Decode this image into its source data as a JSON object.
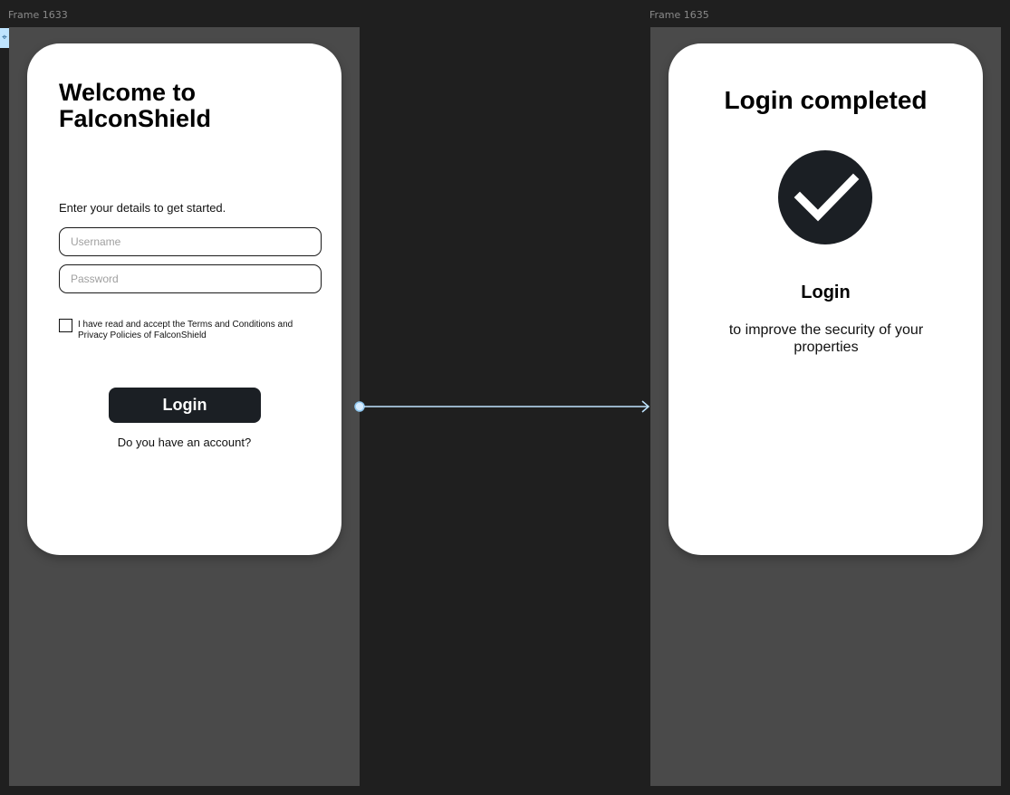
{
  "frames": [
    {
      "label": "Frame 1633"
    },
    {
      "label": "Frame 1635"
    }
  ],
  "login_screen": {
    "title": "Welcome to FalconShield",
    "intro": "Enter your details to get started.",
    "username_placeholder": "Username",
    "password_placeholder": "Password",
    "terms_text": "I have read and accept the Terms and Conditions and Privacy Policies of FalconShield",
    "login_button": "Login",
    "account_link": "Do you have an account?"
  },
  "completed_screen": {
    "title": "Login completed",
    "icon": "checkmark-icon",
    "subtitle": "Login",
    "description": "to improve the security of your properties"
  },
  "colors": {
    "canvas": "#1f1f1f",
    "frame": "#4a4a4a",
    "card": "#ffffff",
    "primary": "#1b1f24",
    "connector": "#bfe4ff"
  }
}
